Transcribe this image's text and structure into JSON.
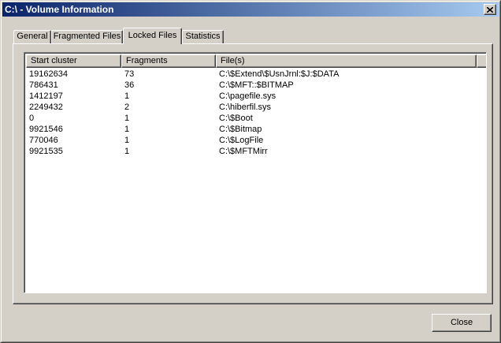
{
  "window": {
    "title": "C:\\ - Volume Information",
    "close_icon": "close-icon"
  },
  "tabs": [
    {
      "label": "General",
      "active": false
    },
    {
      "label": "Fragmented Files",
      "active": false
    },
    {
      "label": "Locked Files",
      "active": true
    },
    {
      "label": "Statistics",
      "active": false
    }
  ],
  "list": {
    "columns": [
      "Start cluster",
      "Fragments",
      "File(s)"
    ],
    "rows": [
      {
        "start_cluster": "19162634",
        "fragments": "73",
        "file": "C:\\$Extend\\$UsnJrnl:$J:$DATA"
      },
      {
        "start_cluster": "786431",
        "fragments": "36",
        "file": "C:\\$MFT::$BITMAP"
      },
      {
        "start_cluster": "1412197",
        "fragments": "1",
        "file": "C:\\pagefile.sys"
      },
      {
        "start_cluster": "2249432",
        "fragments": "2",
        "file": "C:\\hiberfil.sys"
      },
      {
        "start_cluster": "0",
        "fragments": "1",
        "file": "C:\\$Boot"
      },
      {
        "start_cluster": "9921546",
        "fragments": "1",
        "file": "C:\\$Bitmap"
      },
      {
        "start_cluster": "770046",
        "fragments": "1",
        "file": "C:\\$LogFile"
      },
      {
        "start_cluster": "9921535",
        "fragments": "1",
        "file": "C:\\$MFTMirr"
      }
    ]
  },
  "footer": {
    "close_label": "Close"
  },
  "colors": {
    "titlebar_start": "#0a246a",
    "titlebar_end": "#a6caf0",
    "face": "#d4d0c8"
  }
}
